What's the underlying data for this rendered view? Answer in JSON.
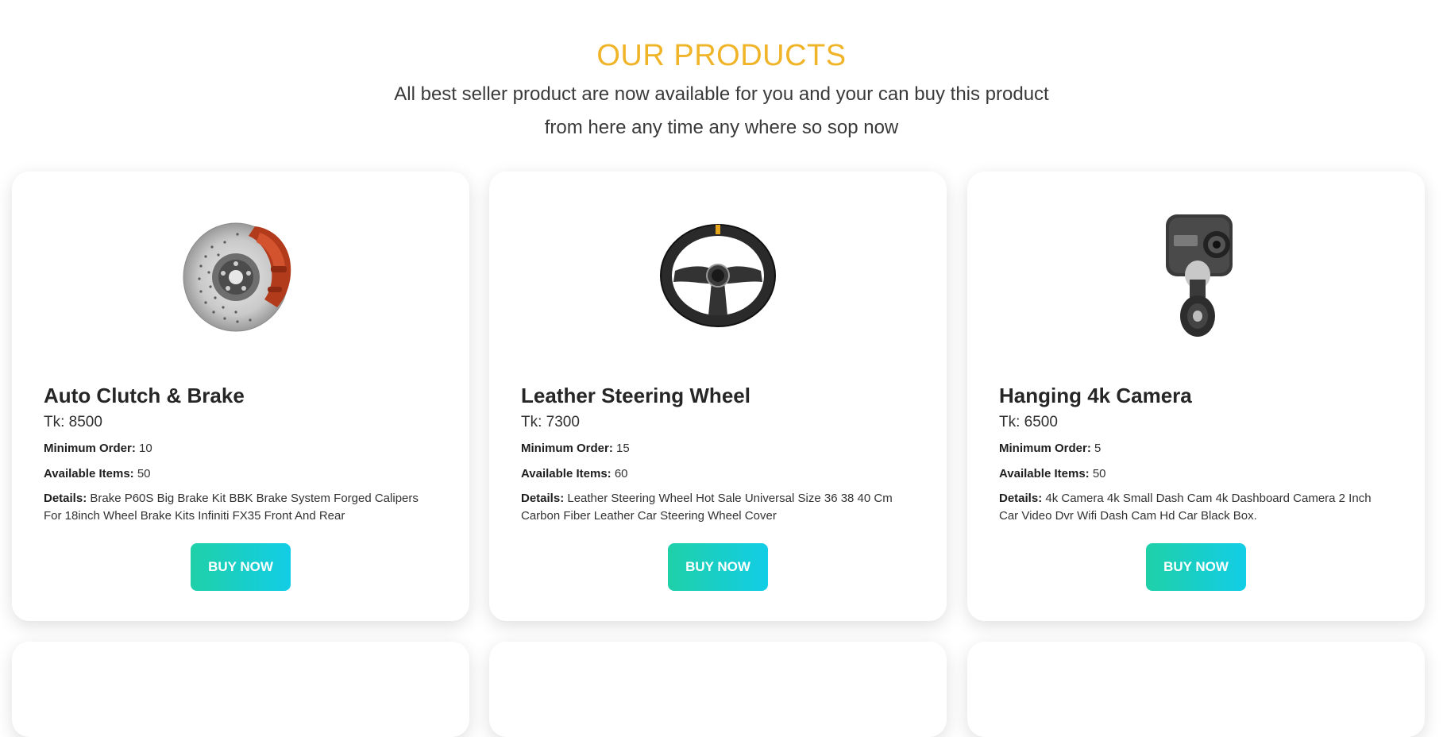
{
  "colors": {
    "title": "#f0b429",
    "button_start": "#1fd0a8",
    "button_end": "#12cde6"
  },
  "header": {
    "title": "OUR PRODUCTS",
    "subtitle": "All best seller product are now available for you and your can buy this product from here any time any where so sop now"
  },
  "labels": {
    "min_order": "Minimum Order:",
    "available": "Available Items:",
    "details": "Details:"
  },
  "products": [
    {
      "name": "Auto Clutch & Brake",
      "price": "Tk: 8500",
      "min_order": "10",
      "available": "50",
      "details": "Brake P60S Big Brake Kit BBK Brake System Forged Calipers For 18inch Wheel Brake Kits Infiniti FX35 Front And Rear",
      "button": "BUY NOW",
      "icon": "brake-disc-icon"
    },
    {
      "name": "Leather Steering Wheel",
      "price": "Tk: 7300",
      "min_order": "15",
      "available": "60",
      "details": "Leather Steering Wheel Hot Sale Universal Size 36 38 40 Cm Carbon Fiber Leather Car Steering Wheel Cover",
      "button": "BUY NOW",
      "icon": "steering-wheel-icon"
    },
    {
      "name": "Hanging 4k Camera",
      "price": "Tk: 6500",
      "min_order": "5",
      "available": "50",
      "details": "4k Camera 4k Small Dash Cam 4k Dashboard Camera 2 Inch Car Video Dvr Wifi Dash Cam Hd Car Black Box.",
      "button": "BUY NOW",
      "icon": "dash-camera-icon"
    }
  ]
}
